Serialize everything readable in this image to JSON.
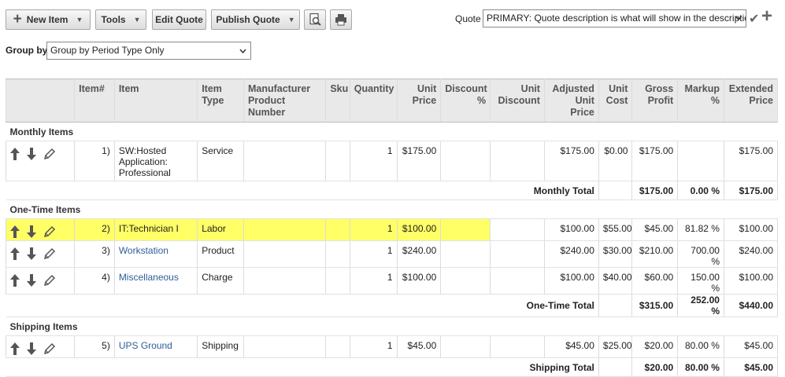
{
  "toolbar": {
    "new_item": "New Item",
    "tools": "Tools",
    "edit_quote": "Edit Quote",
    "publish_quote": "Publish Quote",
    "quote_label": "Quote",
    "quote_value": "PRIMARY: Quote description is what will show in the description"
  },
  "group_by": {
    "label": "Group by",
    "value": "Group by Period Type Only"
  },
  "columns": {
    "item_num": "Item#",
    "item": "Item",
    "item_type": "Item Type",
    "manufacturer": "Manufacturer Product Number",
    "sku": "Sku",
    "quantity": "Quantity",
    "unit_price": "Unit Price",
    "discount_pct": "Discount %",
    "unit_discount": "Unit Discount",
    "adjusted_unit_price": "Adjusted Unit Price",
    "unit_cost": "Unit Cost",
    "gross_profit": "Gross Profit",
    "markup_pct": "Markup %",
    "extended_price": "Extended Price"
  },
  "groups": [
    {
      "name": "Monthly Items",
      "items": [
        {
          "num": "1)",
          "item": "SW:Hosted Application: Professional",
          "type": "Service",
          "manufacturer": "",
          "sku": "",
          "qty": "1",
          "unit_price": "$175.00",
          "discount_pct": "",
          "unit_discount": "",
          "adjusted": "$175.00",
          "cost": "$0.00",
          "gross_profit": "$175.00",
          "markup": "",
          "extended": "$175.00"
        }
      ],
      "total": {
        "label": "Monthly Total",
        "gross_profit": "$175.00",
        "markup": "0.00 %",
        "extended": "$175.00"
      }
    },
    {
      "name": "One-Time Items",
      "items": [
        {
          "num": "2)",
          "item": "IT:Technician I",
          "type": "Labor",
          "manufacturer": "",
          "sku": "",
          "qty": "1",
          "unit_price": "$100.00",
          "discount_pct": "",
          "unit_discount": "",
          "adjusted": "$100.00",
          "cost": "$55.00",
          "gross_profit": "$45.00",
          "markup": "81.82 %",
          "extended": "$100.00"
        },
        {
          "num": "3)",
          "item": "Workstation",
          "type": "Product",
          "manufacturer": "",
          "sku": "",
          "qty": "1",
          "unit_price": "$240.00",
          "discount_pct": "",
          "unit_discount": "",
          "adjusted": "$240.00",
          "cost": "$30.00",
          "gross_profit": "$210.00",
          "markup": "700.00 %",
          "extended": "$240.00"
        },
        {
          "num": "4)",
          "item": "Miscellaneous",
          "type": "Charge",
          "manufacturer": "",
          "sku": "",
          "qty": "1",
          "unit_price": "$100.00",
          "discount_pct": "",
          "unit_discount": "",
          "adjusted": "$100.00",
          "cost": "$40.00",
          "gross_profit": "$60.00",
          "markup": "150.00 %",
          "extended": "$100.00"
        }
      ],
      "total": {
        "label": "One-Time Total",
        "gross_profit": "$315.00",
        "markup": "252.00 %",
        "extended": "$440.00"
      }
    },
    {
      "name": "Shipping Items",
      "items": [
        {
          "num": "5)",
          "item": "UPS Ground",
          "type": "Shipping",
          "manufacturer": "",
          "sku": "",
          "qty": "1",
          "unit_price": "$45.00",
          "discount_pct": "",
          "unit_discount": "",
          "adjusted": "$45.00",
          "cost": "$25.00",
          "gross_profit": "$20.00",
          "markup": "80.00 %",
          "extended": "$45.00"
        }
      ],
      "total": {
        "label": "Shipping Total",
        "gross_profit": "$20.00",
        "markup": "80.00 %",
        "extended": "$45.00"
      }
    }
  ],
  "colors": {
    "highlight": "#ffff66",
    "link": "#2e5e9a",
    "header_bg": "#e9e9e9"
  }
}
